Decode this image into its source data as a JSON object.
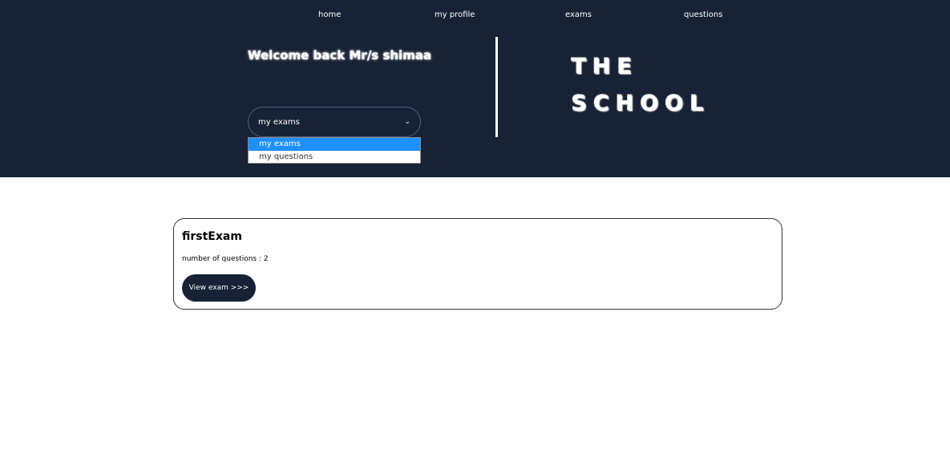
{
  "nav": {
    "items": [
      {
        "label": "home"
      },
      {
        "label": "my profile"
      },
      {
        "label": "exams"
      },
      {
        "label": "questions"
      }
    ]
  },
  "header": {
    "welcome": "Welcome back Mr/s shimaa",
    "logo_line1": "THE",
    "logo_line2": "SCHOOL"
  },
  "select": {
    "value": "my exams",
    "options": [
      "my exams",
      "my questions"
    ]
  },
  "exams": [
    {
      "title": "firstExam",
      "questions_text": "number of questions : 2",
      "button_label": "View exam >>>"
    }
  ],
  "colors": {
    "header_bg": "#172236",
    "selected_option": "#1e90ff",
    "button_bg": "#172236"
  }
}
